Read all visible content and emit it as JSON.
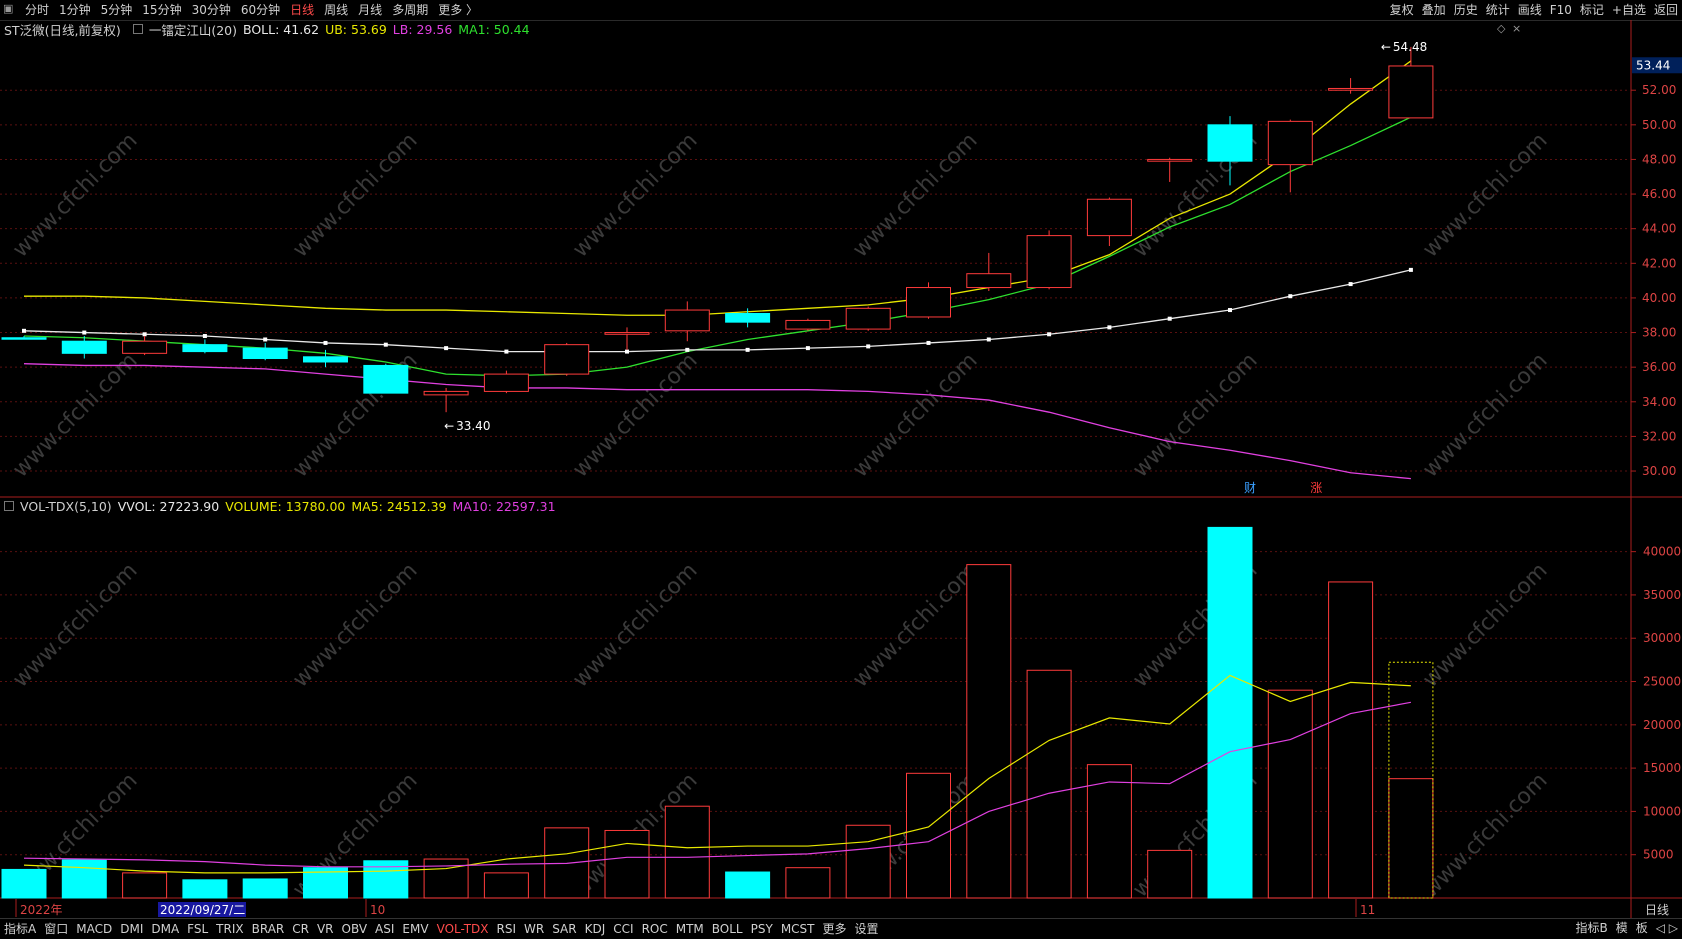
{
  "toolbar": {
    "periods": [
      "分时",
      "1分钟",
      "5分钟",
      "15分钟",
      "30分钟",
      "60分钟",
      "日线",
      "周线",
      "月线",
      "多周期",
      "更多 〉"
    ],
    "active_period": "日线",
    "right_buttons": [
      "复权",
      "叠加",
      "历史",
      "统计",
      "画线",
      "F10",
      "标记",
      "+自选",
      "返回"
    ]
  },
  "price_panel": {
    "title": "ST泛微(日线,前复权)",
    "indicator_name": "一镭定江山(20)",
    "boll_label": "BOLL: 41.62",
    "ub_label": "UB: 53.69",
    "lb_label": "LB: 29.56",
    "ma1_label": "MA1: 50.44",
    "high_marker": "54.48",
    "low_marker": "33.40",
    "current_price": "53.44",
    "y_ticks": [
      "52.00",
      "50.00",
      "48.00",
      "46.00",
      "44.00",
      "42.00",
      "40.00",
      "38.00",
      "36.00",
      "34.00",
      "32.00",
      "30.00"
    ],
    "event_tags": [
      {
        "text": "财",
        "color": "#3aa0ff"
      },
      {
        "text": "涨",
        "color": "#ff3b3b"
      }
    ]
  },
  "volume_panel": {
    "title": "VOL-TDX(5,10)",
    "vvol_label": "VVOL: 27223.90",
    "volume_label": "VOLUME: 13780.00",
    "ma5_label": "MA5: 24512.39",
    "ma10_label": "MA10: 22597.31",
    "y_ticks": [
      "40000",
      "35000",
      "30000",
      "25000",
      "20000",
      "15000",
      "10000",
      "5000"
    ]
  },
  "x_axis": {
    "labels": [
      "2022年",
      "2022/09/27/二",
      "10",
      "11"
    ],
    "right_label": "日线"
  },
  "bottom_bar": {
    "left_tab": "指标A",
    "window_tab": "窗口",
    "indicators": [
      "MACD",
      "DMI",
      "DMA",
      "FSL",
      "TRIX",
      "BRAR",
      "CR",
      "VR",
      "OBV",
      "ASI",
      "EMV",
      "VOL-TDX",
      "RSI",
      "WR",
      "SAR",
      "KDJ",
      "CCI",
      "ROC",
      "MTM",
      "BOLL",
      "PSY",
      "MCST",
      "更多",
      "设置"
    ],
    "active_indicator": "VOL-TDX",
    "right_items": [
      "指标B",
      "模",
      "板"
    ]
  },
  "watermark": "www.cfchi.com",
  "chart_data": {
    "type": "candlestick",
    "candles": [
      {
        "o": 37.7,
        "c": 37.7,
        "h": 37.8,
        "l": 37.6,
        "up": false
      },
      {
        "o": 37.5,
        "c": 36.8,
        "h": 37.8,
        "l": 36.5,
        "up": false
      },
      {
        "o": 36.8,
        "c": 37.5,
        "h": 37.8,
        "l": 36.7,
        "up": true
      },
      {
        "o": 37.3,
        "c": 36.9,
        "h": 37.6,
        "l": 36.8,
        "up": false
      },
      {
        "o": 37.1,
        "c": 36.5,
        "h": 37.4,
        "l": 36.4,
        "up": false
      },
      {
        "o": 36.6,
        "c": 36.3,
        "h": 37.0,
        "l": 36.0,
        "up": false
      },
      {
        "o": 36.1,
        "c": 34.5,
        "h": 36.2,
        "l": 34.5,
        "up": false
      },
      {
        "o": 34.4,
        "c": 34.6,
        "h": 34.8,
        "l": 33.4,
        "up": true
      },
      {
        "o": 34.6,
        "c": 35.6,
        "h": 35.8,
        "l": 34.5,
        "up": true
      },
      {
        "o": 35.6,
        "c": 37.3,
        "h": 37.4,
        "l": 35.5,
        "up": true
      },
      {
        "o": 37.9,
        "c": 38.0,
        "h": 38.3,
        "l": 37.0,
        "up": true
      },
      {
        "o": 38.1,
        "c": 39.3,
        "h": 39.8,
        "l": 37.5,
        "up": true
      },
      {
        "o": 39.1,
        "c": 38.6,
        "h": 39.4,
        "l": 38.3,
        "up": false
      },
      {
        "o": 38.2,
        "c": 38.7,
        "h": 38.8,
        "l": 38.1,
        "up": true
      },
      {
        "o": 38.2,
        "c": 39.4,
        "h": 39.5,
        "l": 38.1,
        "up": true
      },
      {
        "o": 38.9,
        "c": 40.6,
        "h": 40.9,
        "l": 38.8,
        "up": true
      },
      {
        "o": 40.6,
        "c": 41.4,
        "h": 42.6,
        "l": 40.4,
        "up": true
      },
      {
        "o": 40.6,
        "c": 43.6,
        "h": 43.9,
        "l": 40.5,
        "up": true
      },
      {
        "o": 43.6,
        "c": 45.7,
        "h": 45.8,
        "l": 43.0,
        "up": true
      },
      {
        "o": 47.9,
        "c": 48.0,
        "h": 48.1,
        "l": 46.7,
        "up": true
      },
      {
        "o": 50.0,
        "c": 47.9,
        "h": 50.5,
        "l": 46.5,
        "up": false
      },
      {
        "o": 47.7,
        "c": 50.2,
        "h": 50.3,
        "l": 46.1,
        "up": true
      },
      {
        "o": 52.0,
        "c": 52.1,
        "h": 52.7,
        "l": 51.8,
        "up": true
      },
      {
        "o": 50.4,
        "c": 53.4,
        "h": 54.5,
        "l": 50.4,
        "up": true
      }
    ],
    "ub": [
      40.1,
      40.1,
      40.0,
      39.8,
      39.6,
      39.4,
      39.3,
      39.3,
      39.2,
      39.1,
      39.0,
      39.0,
      39.2,
      39.4,
      39.6,
      40.0,
      40.6,
      41.2,
      42.5,
      44.6,
      46.0,
      48.4,
      51.2,
      53.69
    ],
    "boll": [
      38.1,
      38.0,
      37.9,
      37.8,
      37.6,
      37.4,
      37.3,
      37.1,
      36.9,
      36.9,
      36.9,
      37.0,
      37.0,
      37.1,
      37.2,
      37.4,
      37.6,
      37.9,
      38.3,
      38.8,
      39.3,
      40.1,
      40.8,
      41.62
    ],
    "lb": [
      36.2,
      36.1,
      36.1,
      36.0,
      35.9,
      35.6,
      35.3,
      35.0,
      34.8,
      34.8,
      34.7,
      34.7,
      34.7,
      34.7,
      34.6,
      34.4,
      34.1,
      33.4,
      32.5,
      31.7,
      31.2,
      30.6,
      29.9,
      29.56
    ],
    "ma1": [
      37.8,
      37.7,
      37.5,
      37.3,
      37.1,
      36.8,
      36.3,
      35.6,
      35.5,
      35.6,
      36.0,
      36.9,
      37.6,
      38.1,
      38.6,
      39.2,
      39.9,
      40.8,
      42.4,
      44.1,
      45.4,
      47.3,
      48.8,
      50.44
    ],
    "volume": [
      3300,
      4400,
      2900,
      2100,
      2200,
      3500,
      4300,
      4500,
      2900,
      8100,
      7800,
      10600,
      3000,
      3500,
      8400,
      14400,
      38500,
      26300,
      15400,
      5500,
      42800,
      24000,
      36500,
      13780
    ],
    "vol_up": [
      false,
      false,
      true,
      false,
      false,
      false,
      false,
      true,
      true,
      true,
      true,
      true,
      false,
      true,
      true,
      true,
      true,
      true,
      true,
      true,
      false,
      true,
      true,
      true
    ],
    "vvol_last": 27223.9,
    "ma5": [
      4100,
      3800,
      3500,
      3100,
      2900,
      2900,
      3000,
      3100,
      3400,
      4500,
      5100,
      6300,
      5800,
      6000,
      6000,
      6500,
      8200,
      13800,
      18200,
      20800,
      20100,
      25700,
      22700,
      24900,
      24512
    ],
    "ma10": [
      4700,
      4600,
      4500,
      4400,
      4200,
      3800,
      3600,
      3600,
      3700,
      3900,
      4000,
      4700,
      4700,
      4900,
      5100,
      5700,
      6500,
      10000,
      12100,
      13400,
      13200,
      16900,
      18300,
      21300,
      22597
    ],
    "price_range": [
      28.5,
      54.9
    ],
    "volume_range": [
      0,
      44000
    ]
  }
}
